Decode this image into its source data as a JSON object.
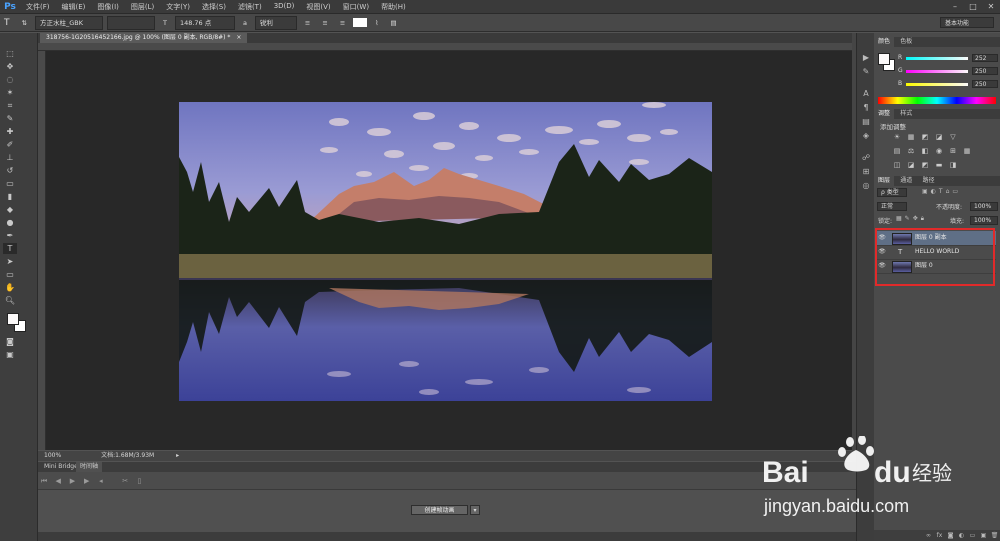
{
  "app": {
    "logo": "Ps"
  },
  "menubar": {
    "items": [
      "文件(F)",
      "编辑(E)",
      "图像(I)",
      "图层(L)",
      "文字(Y)",
      "选择(S)",
      "滤镜(T)",
      "3D(D)",
      "视图(V)",
      "窗口(W)",
      "帮助(H)"
    ],
    "window_controls": [
      "–",
      "□",
      "✕"
    ]
  },
  "options": {
    "tool_icon": "T",
    "font_family": "方正水柱_GBK",
    "font_size": "148.76 点",
    "antialias": "锐利",
    "workspace": "基本功能"
  },
  "document": {
    "tab_title": "318756-1G20516452166.jpg @ 100% (图层 0 副本, RGB/8#) *",
    "tab_close": "×"
  },
  "status": {
    "zoom": "100%",
    "doc_info": "文档:1.68M/3.93M"
  },
  "bottom_tabs": [
    "Mini Bridge",
    "时间轴"
  ],
  "timeline": {
    "create_button": "创建帧动画"
  },
  "color_panel": {
    "tabs": [
      "颜色",
      "色板"
    ],
    "channels": [
      {
        "label": "R",
        "value": "252"
      },
      {
        "label": "G",
        "value": "250"
      },
      {
        "label": "B",
        "value": "250"
      }
    ]
  },
  "adjust_panel": {
    "tabs": [
      "调整",
      "样式"
    ],
    "title": "添加调整",
    "icons_row1": [
      "☀",
      "▦",
      "◩",
      "◪",
      "▽"
    ],
    "icons_row2": [
      "▤",
      "⚖",
      "◧",
      "◉",
      "⊞",
      "▦"
    ],
    "icons_row3": [
      "◫",
      "◪",
      "◩",
      "▬",
      "◨"
    ]
  },
  "layers_panel": {
    "tabs": [
      "图层",
      "通道",
      "路径"
    ],
    "kind": "ρ 类型",
    "blend_mode": "正常",
    "opacity_label": "不透明度:",
    "opacity_value": "100%",
    "lock_label": "锁定:",
    "fill_label": "填充:",
    "fill_value": "100%",
    "layers": [
      {
        "name": "图层 0 副本",
        "type": "image",
        "selected": true
      },
      {
        "name": "HELLO WORLD",
        "type": "text",
        "selected": false
      },
      {
        "name": "图层 0",
        "type": "image",
        "selected": false
      }
    ]
  },
  "watermark": {
    "brand": "Bai du 经验",
    "url": "jingyan.baidu.com"
  },
  "colors": {
    "accent_selection": "#5f6f86",
    "highlight_box": "#e12a2a",
    "ps_blue": "#4aa3ff"
  }
}
